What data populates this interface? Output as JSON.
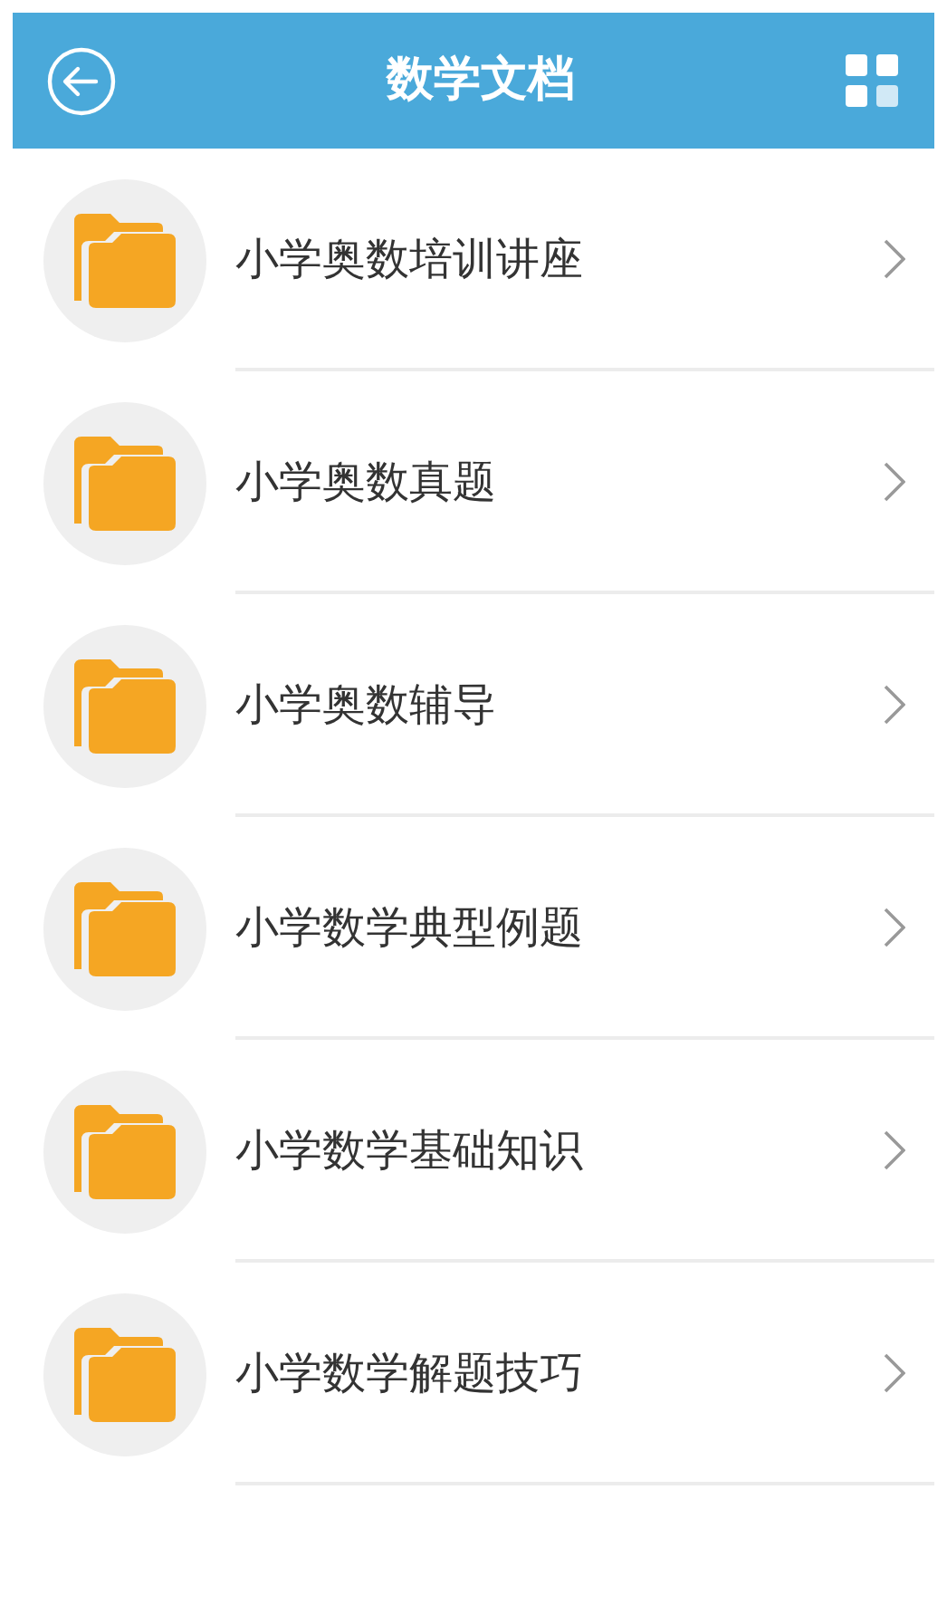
{
  "header": {
    "title": "数学文档"
  },
  "items": [
    {
      "label": "小学奥数培训讲座"
    },
    {
      "label": "小学奥数真题"
    },
    {
      "label": "小学奥数辅导"
    },
    {
      "label": "小学数学典型例题"
    },
    {
      "label": "小学数学基础知识"
    },
    {
      "label": "小学数学解题技巧"
    }
  ]
}
